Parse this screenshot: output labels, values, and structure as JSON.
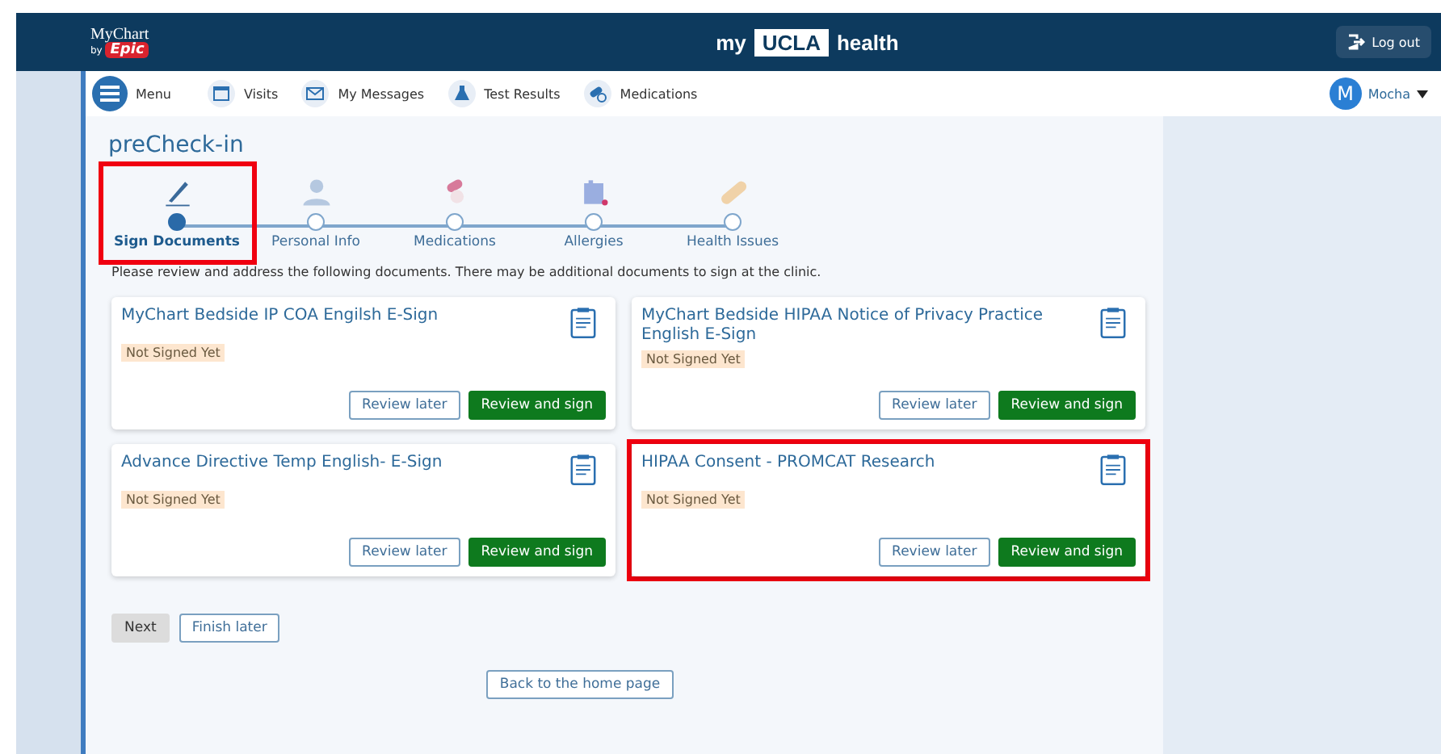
{
  "header": {
    "logo": {
      "name": "MyChart",
      "byline": "by",
      "brand": "Epic"
    },
    "site": {
      "prefix": "my",
      "badge": "UCLA",
      "suffix": "health"
    },
    "logout": "Log out"
  },
  "nav": {
    "items": [
      {
        "kind": "menu",
        "label": "Menu"
      },
      {
        "kind": "calendar",
        "label": "Visits"
      },
      {
        "kind": "mail",
        "label": "My Messages"
      },
      {
        "kind": "flask",
        "label": "Test Results"
      },
      {
        "kind": "pills",
        "label": "Medications"
      }
    ],
    "user": {
      "initial": "M",
      "name": "Mocha"
    }
  },
  "page": {
    "title": "preCheck-in",
    "steps": [
      {
        "kind": "pen",
        "label": "Sign Documents",
        "selected": true,
        "highlighted": true
      },
      {
        "kind": "person",
        "label": "Personal Info",
        "selected": false,
        "highlighted": false
      },
      {
        "kind": "pills",
        "label": "Medications",
        "selected": false,
        "highlighted": false
      },
      {
        "kind": "allergy",
        "label": "Allergies",
        "selected": false,
        "highlighted": false
      },
      {
        "kind": "bandage",
        "label": "Health Issues",
        "selected": false,
        "highlighted": false
      }
    ],
    "instructions": "Please review and address the following documents. There may be additional documents to sign at the clinic.",
    "documents": [
      {
        "title": "MyChart Bedside IP COA Engilsh E-Sign",
        "status": "Not Signed Yet",
        "highlighted": false,
        "buttons": [
          "Review later",
          "Review and sign"
        ]
      },
      {
        "title": "MyChart Bedside HIPAA Notice of Privacy Practice English E-Sign",
        "status": "Not Signed Yet",
        "highlighted": false,
        "buttons": [
          "Review later",
          "Review and sign"
        ]
      },
      {
        "title": "Advance Directive Temp English- E-Sign",
        "status": "Not Signed Yet",
        "highlighted": false,
        "buttons": [
          "Review later",
          "Review and sign"
        ]
      },
      {
        "title": "HIPAA Consent - PROMCAT Research",
        "status": "Not Signed Yet",
        "highlighted": true,
        "buttons": [
          "Review later",
          "Review and sign"
        ]
      }
    ],
    "next": {
      "label": "Next",
      "disabled": true
    },
    "finish_later": "Finish later",
    "back_home": "Back to the home page"
  }
}
